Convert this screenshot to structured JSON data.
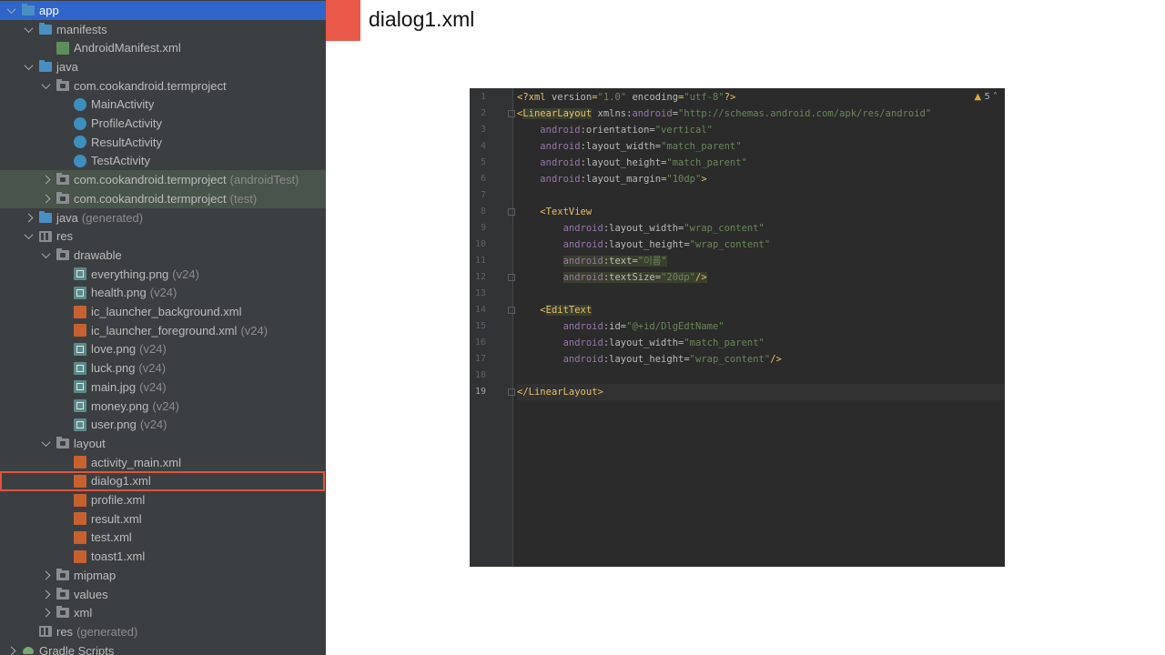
{
  "tree": [
    {
      "label": "app",
      "indent": 0,
      "chev": "open",
      "icon": "folder-blue",
      "state": "selected"
    },
    {
      "label": "manifests",
      "indent": 1,
      "chev": "open",
      "icon": "folder-blue"
    },
    {
      "label": "AndroidManifest.xml",
      "indent": 2,
      "chev": "none",
      "icon": "manifest"
    },
    {
      "label": "java",
      "indent": 1,
      "chev": "open",
      "icon": "folder-blue"
    },
    {
      "label": "com.cookandroid.termproject",
      "indent": 2,
      "chev": "open",
      "icon": "folder-gray"
    },
    {
      "label": "MainActivity",
      "indent": 3,
      "chev": "none",
      "icon": "class"
    },
    {
      "label": "ProfileActivity",
      "indent": 3,
      "chev": "none",
      "icon": "class"
    },
    {
      "label": "ResultActivity",
      "indent": 3,
      "chev": "none",
      "icon": "class"
    },
    {
      "label": "TestActivity",
      "indent": 3,
      "chev": "none",
      "icon": "class"
    },
    {
      "label": "com.cookandroid.termproject",
      "suffix": "(androidTest)",
      "indent": 2,
      "chev": "closed",
      "icon": "folder-gray",
      "state": "highlight"
    },
    {
      "label": "com.cookandroid.termproject",
      "suffix": "(test)",
      "indent": 2,
      "chev": "closed",
      "icon": "folder-gray",
      "state": "highlight"
    },
    {
      "label": "java",
      "suffix": "(generated)",
      "indent": 1,
      "chev": "closed",
      "icon": "folder-blue"
    },
    {
      "label": "res",
      "indent": 1,
      "chev": "open",
      "icon": "folder-res"
    },
    {
      "label": "drawable",
      "indent": 2,
      "chev": "open",
      "icon": "folder-gray"
    },
    {
      "label": "everything.png",
      "suffix": "(v24)",
      "indent": 3,
      "chev": "none",
      "icon": "img"
    },
    {
      "label": "health.png",
      "suffix": "(v24)",
      "indent": 3,
      "chev": "none",
      "icon": "img"
    },
    {
      "label": "ic_launcher_background.xml",
      "indent": 3,
      "chev": "none",
      "icon": "xml"
    },
    {
      "label": "ic_launcher_foreground.xml",
      "suffix": "(v24)",
      "indent": 3,
      "chev": "none",
      "icon": "xml"
    },
    {
      "label": "love.png",
      "suffix": "(v24)",
      "indent": 3,
      "chev": "none",
      "icon": "img"
    },
    {
      "label": "luck.png",
      "suffix": "(v24)",
      "indent": 3,
      "chev": "none",
      "icon": "img"
    },
    {
      "label": "main.jpg",
      "suffix": "(v24)",
      "indent": 3,
      "chev": "none",
      "icon": "img"
    },
    {
      "label": "money.png",
      "suffix": "(v24)",
      "indent": 3,
      "chev": "none",
      "icon": "img"
    },
    {
      "label": "user.png",
      "suffix": "(v24)",
      "indent": 3,
      "chev": "none",
      "icon": "img"
    },
    {
      "label": "layout",
      "indent": 2,
      "chev": "open",
      "icon": "folder-gray"
    },
    {
      "label": "activity_main.xml",
      "indent": 3,
      "chev": "none",
      "icon": "xml"
    },
    {
      "label": "dialog1.xml",
      "indent": 3,
      "chev": "none",
      "icon": "xml"
    },
    {
      "label": "profile.xml",
      "indent": 3,
      "chev": "none",
      "icon": "xml"
    },
    {
      "label": "result.xml",
      "indent": 3,
      "chev": "none",
      "icon": "xml"
    },
    {
      "label": "test.xml",
      "indent": 3,
      "chev": "none",
      "icon": "xml"
    },
    {
      "label": "toast1.xml",
      "indent": 3,
      "chev": "none",
      "icon": "xml"
    },
    {
      "label": "mipmap",
      "indent": 2,
      "chev": "closed",
      "icon": "folder-gray"
    },
    {
      "label": "values",
      "indent": 2,
      "chev": "closed",
      "icon": "folder-gray"
    },
    {
      "label": "xml",
      "indent": 2,
      "chev": "closed",
      "icon": "folder-gray"
    },
    {
      "label": "res",
      "suffix": "(generated)",
      "indent": 1,
      "chev": "none",
      "icon": "folder-res"
    },
    {
      "label": "Gradle Scripts",
      "indent": 0,
      "chev": "closed",
      "icon": "gradle"
    }
  ],
  "title": "dialog1.xml",
  "editor": {
    "warning_count": "5",
    "current_line": 19,
    "lines": [
      [
        [
          "pun",
          "<?"
        ],
        [
          "tag",
          "xml "
        ],
        [
          "attr",
          "version"
        ],
        [
          "tag",
          "="
        ],
        [
          "val",
          "\"1.0\""
        ],
        [
          "attr",
          " encoding"
        ],
        [
          "tag",
          "="
        ],
        [
          "val",
          "\"utf-8\""
        ],
        [
          "pun",
          "?>"
        ]
      ],
      [
        [
          "pun",
          "<"
        ],
        [
          "tag",
          "LinearLayout"
        ],
        [
          "attr",
          " xmlns:"
        ],
        [
          "ns",
          "android"
        ],
        [
          "attr",
          "="
        ],
        [
          "val",
          "\"http://schemas.android.com/apk/res/android\""
        ]
      ],
      [
        [
          "attr",
          "    "
        ],
        [
          "ns",
          "android"
        ],
        [
          "attr",
          ":orientation="
        ],
        [
          "val",
          "\"vertical\""
        ]
      ],
      [
        [
          "attr",
          "    "
        ],
        [
          "ns",
          "android"
        ],
        [
          "attr",
          ":layout_width="
        ],
        [
          "val",
          "\"match_parent\""
        ]
      ],
      [
        [
          "attr",
          "    "
        ],
        [
          "ns",
          "android"
        ],
        [
          "attr",
          ":layout_height="
        ],
        [
          "val",
          "\"match_parent\""
        ]
      ],
      [
        [
          "attr",
          "    "
        ],
        [
          "ns",
          "android"
        ],
        [
          "attr",
          ":layout_margin="
        ],
        [
          "val",
          "\"10dp\""
        ],
        [
          "pun",
          ">"
        ]
      ],
      [],
      [
        [
          "attr",
          "    "
        ],
        [
          "pun",
          "<"
        ],
        [
          "tag",
          "TextView"
        ]
      ],
      [
        [
          "attr",
          "        "
        ],
        [
          "ns",
          "android"
        ],
        [
          "attr",
          ":layout_width="
        ],
        [
          "val",
          "\"wrap_content\""
        ]
      ],
      [
        [
          "attr",
          "        "
        ],
        [
          "ns",
          "android"
        ],
        [
          "attr",
          ":layout_height="
        ],
        [
          "val",
          "\"wrap_content\""
        ]
      ],
      [
        [
          "attr",
          "        "
        ],
        [
          "ns",
          "android"
        ],
        [
          "attr",
          ":text="
        ],
        [
          "val",
          "\"이름\""
        ]
      ],
      [
        [
          "attr",
          "        "
        ],
        [
          "ns",
          "android"
        ],
        [
          "attr",
          ":textSize="
        ],
        [
          "val",
          "\"20dp\""
        ],
        [
          "pun",
          "/>"
        ]
      ],
      [],
      [
        [
          "attr",
          "    "
        ],
        [
          "pun",
          "<"
        ],
        [
          "tag",
          "EditText"
        ]
      ],
      [
        [
          "attr",
          "        "
        ],
        [
          "ns",
          "android"
        ],
        [
          "attr",
          ":id="
        ],
        [
          "val",
          "\"@+id/DlgEdtName\""
        ]
      ],
      [
        [
          "attr",
          "        "
        ],
        [
          "ns",
          "android"
        ],
        [
          "attr",
          ":layout_width="
        ],
        [
          "val",
          "\"match_parent\""
        ]
      ],
      [
        [
          "attr",
          "        "
        ],
        [
          "ns",
          "android"
        ],
        [
          "attr",
          ":layout_height="
        ],
        [
          "val",
          "\"wrap_content\""
        ],
        [
          "pun",
          "/>"
        ]
      ],
      [],
      [
        [
          "pun",
          "</"
        ],
        [
          "tag",
          "LinearLayout"
        ],
        [
          "pun",
          ">"
        ]
      ]
    ]
  }
}
